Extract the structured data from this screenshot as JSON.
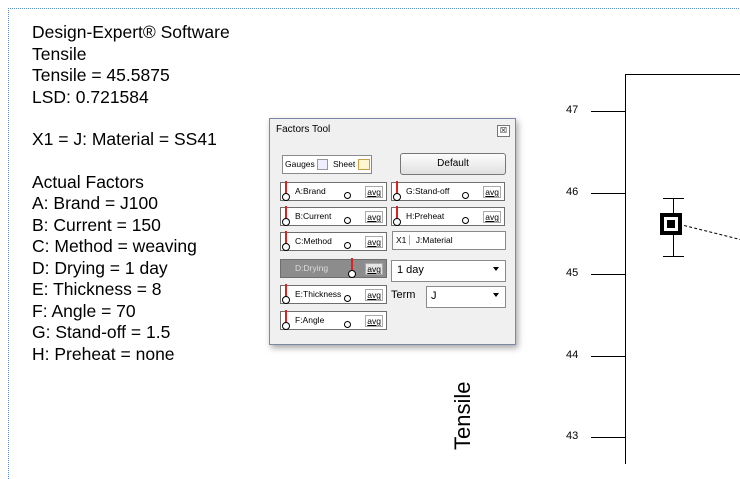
{
  "info": {
    "lines": [
      "Design-Expert® Software",
      "Tensile",
      "Tensile = 45.5875",
      "LSD: 0.721584"
    ],
    "x1": "X1 = J: Material = SS41",
    "actual_title": "Actual Factors",
    "factors": [
      "A: Brand = J100",
      "B: Current = 150",
      "C: Method = weaving",
      "D: Drying = 1 day",
      "E: Thickness = 8",
      "F: Angle = 70",
      "G: Stand-off = 1.5",
      "H: Preheat = none"
    ]
  },
  "plot": {
    "ylabel": "Tensile",
    "ticks": [
      "47",
      "46",
      "45",
      "44",
      "43"
    ],
    "point_value": 45.5875,
    "lsd": 0.721584
  },
  "tool": {
    "title": "Factors Tool",
    "close": "☒",
    "tab_gauges": "Gauges",
    "tab_sheet": "Sheet",
    "default_label": "Default",
    "gauges_left": [
      "A:Brand",
      "B:Current",
      "C:Method",
      "D:Drying",
      "E:Thickness",
      "F:Angle"
    ],
    "gauges_right": [
      "G:Stand-off",
      "H:Preheat"
    ],
    "avg": "avg",
    "x1_label": "X1",
    "x1_value": "J:Material",
    "drying_value": "1 day",
    "term_label": "Term",
    "term_value": "J"
  }
}
